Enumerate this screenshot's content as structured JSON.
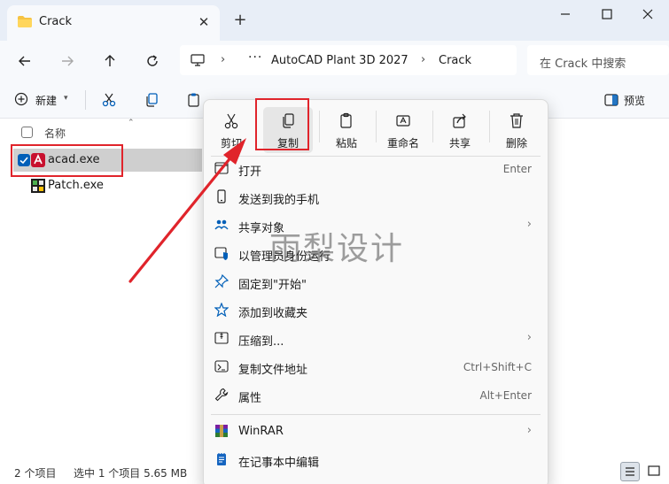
{
  "window": {
    "tab_title": "Crack",
    "tab_close": "✕",
    "new_tab": "+"
  },
  "address": {
    "overflow": "···",
    "crumbs": [
      "AutoCAD Plant 3D 2027",
      "Crack"
    ],
    "search_placeholder": "在 Crack 中搜索"
  },
  "toolbar": {
    "new_label": "新建",
    "preview_label": "预览"
  },
  "file_list": {
    "column_name": "名称",
    "files": [
      {
        "name": "acad.exe",
        "selected": true
      },
      {
        "name": "Patch.exe",
        "selected": false
      }
    ]
  },
  "status": {
    "item_count": "2 个项目",
    "selection": "选中 1 个项目  5.65 MB"
  },
  "context_menu": {
    "quick_actions": [
      {
        "label": "剪切",
        "icon": "scissors-icon"
      },
      {
        "label": "复制",
        "icon": "copy-icon"
      },
      {
        "label": "粘贴",
        "icon": "paste-icon"
      },
      {
        "label": "重命名",
        "icon": "rename-icon"
      },
      {
        "label": "共享",
        "icon": "share-icon"
      },
      {
        "label": "删除",
        "icon": "trash-icon"
      }
    ],
    "items": [
      {
        "label": "打开",
        "shortcut": "Enter"
      },
      {
        "label": "发送到我的手机",
        "shortcut": ""
      },
      {
        "label": "共享对象",
        "shortcut": ""
      },
      {
        "label": "以管理员身份运行",
        "shortcut": ""
      },
      {
        "label": "固定到\"开始\"",
        "shortcut": ""
      },
      {
        "label": "添加到收藏夹",
        "shortcut": ""
      },
      {
        "label": "压缩到...",
        "shortcut": ""
      },
      {
        "label": "复制文件地址",
        "shortcut": "Ctrl+Shift+C"
      },
      {
        "label": "属性",
        "shortcut": "Alt+Enter"
      },
      {
        "label": "WinRAR",
        "shortcut": ""
      },
      {
        "label": "在记事本中编辑",
        "shortcut": ""
      }
    ],
    "submenu_arrow": "›"
  },
  "watermark": "雨梨设计",
  "colors": {
    "accent": "#005fb8",
    "highlight_red": "#e0242b",
    "titlebar": "#e8eef7"
  }
}
